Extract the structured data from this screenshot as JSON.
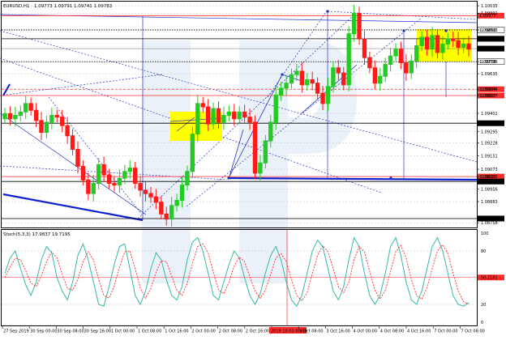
{
  "header": {
    "symbol": "EURUSD,H1",
    "ohlc": "1.09773 1.09791 1.09741 1.09783",
    "indicator": "Stoch(5,3,3) 17.9837 19.7195"
  },
  "colors": {
    "bull": "#22cc22",
    "bear": "#ff1a1a",
    "level": "#ff2a2a",
    "trend": "#2233cc",
    "box": "#ffff00",
    "stoch_main": "#34b8a8",
    "stoch_signal": "#ff2a2a",
    "watermark": "#dbe6f2"
  },
  "chart_data": [
    {
      "type": "candlestick",
      "title": "EURUSD,H1",
      "ylim": [
        1.0874,
        1.1005
      ],
      "y_ticks": [
        "1.10035",
        "1.09991",
        "1.09893",
        "1.09841",
        "1.09783",
        "1.09706",
        "1.09635",
        "1.09544",
        "1.09507",
        "1.09402",
        "1.09344",
        "1.09295",
        "1.09228",
        "1.09151",
        "1.09073",
        "1.09030",
        "1.09001",
        "1.08956",
        "1.08883",
        "1.08783",
        "1.08758"
      ],
      "grid": true,
      "levels": [
        {
          "value": 1.09977,
          "label": "1.09977",
          "style": "red-solid"
        },
        {
          "value": 1.09893,
          "label": "1.09893",
          "style": "black-dotted"
        },
        {
          "value": 1.09841,
          "label": "1.09841",
          "style": "black-solid"
        },
        {
          "value": 1.09783,
          "label": "1.09783",
          "style": "current"
        },
        {
          "value": 1.09706,
          "label": "1.09706",
          "style": "black-dotted"
        },
        {
          "value": 1.09544,
          "label": "1.09544",
          "style": "red-dashed"
        },
        {
          "value": 1.09507,
          "label": "1.09507",
          "style": "red-solid"
        },
        {
          "value": 1.09344,
          "label": "1.09344",
          "style": "black-solid"
        },
        {
          "value": 1.0903,
          "label": "1.09030",
          "style": "red-solid"
        },
        {
          "value": 1.09001,
          "label": "1.09001",
          "style": "black-solid"
        },
        {
          "value": 1.08783,
          "label": "1.08783",
          "style": "black-solid"
        }
      ],
      "anchor_prices": [
        1.094,
        1.0937,
        1.0939,
        1.0941,
        1.0946,
        1.0942,
        1.0936,
        1.0929,
        1.0935,
        1.0939,
        1.0938,
        1.0933,
        1.0927,
        1.0919,
        1.0909,
        1.0901,
        1.0893,
        1.0899,
        1.091,
        1.0904,
        1.0899,
        1.0898,
        1.0902,
        1.0906,
        1.0908,
        1.0899,
        1.0895,
        1.0893,
        1.0891,
        1.0888,
        1.0881,
        1.0878,
        1.0886,
        1.0889,
        1.0898,
        1.0906,
        1.0928,
        1.0946,
        1.0944,
        1.0934,
        1.0943,
        1.0935,
        1.0939,
        1.0941,
        1.0937,
        1.0941,
        1.0938,
        1.0935,
        1.0905,
        1.0911,
        1.0924,
        1.0935,
        1.0951,
        1.0955,
        1.0958,
        1.0963,
        1.0965,
        1.0957,
        1.096,
        1.0958,
        1.0952,
        1.0946,
        1.0956,
        1.0967,
        1.0964,
        1.0957,
        1.0987,
        1.0999,
        1.0984,
        1.0973,
        1.0967,
        1.0958,
        1.0962,
        1.0969,
        1.0974,
        1.0978,
        1.097,
        1.0964,
        1.0971,
        1.098,
        1.0985,
        1.0978,
        1.0986,
        1.0976,
        1.0981,
        1.0984,
        1.0983,
        1.0979,
        1.0981,
        1.0978
      ]
    },
    {
      "type": "line",
      "title": "Stoch(5,3,3) 17.9837 19.7195",
      "ylim": [
        0,
        100
      ],
      "y_ticks": [
        "100",
        "80",
        "50.2181",
        "20",
        "0"
      ],
      "levels": [
        80,
        50.2181,
        20
      ],
      "series": [
        {
          "values": [
            55,
            72,
            80,
            60,
            42,
            30,
            45,
            70,
            85,
            78,
            50,
            35,
            25,
            45,
            75,
            88,
            70,
            45,
            20,
            18,
            40,
            65,
            85,
            88,
            60,
            30,
            20,
            35,
            60,
            78,
            70,
            48,
            30,
            25,
            40,
            70,
            90,
            95,
            80,
            55,
            30,
            25,
            45,
            65,
            80,
            72,
            50,
            30,
            20,
            32,
            55,
            75,
            85,
            70,
            45,
            25,
            18,
            30,
            55,
            80,
            92,
            85,
            60,
            35,
            25,
            40,
            70,
            95,
            85,
            55,
            30,
            20,
            30,
            55,
            85,
            95,
            75,
            45,
            25,
            20,
            35,
            60,
            85,
            95,
            80,
            55,
            30,
            20,
            18,
            22
          ]
        },
        {
          "values": [
            50,
            62,
            72,
            70,
            58,
            44,
            40,
            52,
            68,
            79,
            72,
            54,
            38,
            36,
            48,
            68,
            79,
            70,
            48,
            30,
            27,
            41,
            62,
            79,
            80,
            60,
            38,
            27,
            38,
            56,
            69,
            68,
            52,
            36,
            30,
            44,
            66,
            85,
            88,
            78,
            56,
            36,
            32,
            45,
            63,
            73,
            68,
            51,
            35,
            27,
            36,
            54,
            72,
            77,
            68,
            48,
            30,
            24,
            33,
            55,
            75,
            86,
            79,
            60,
            40,
            33,
            45,
            70,
            85,
            79,
            57,
            36,
            26,
            36,
            57,
            79,
            86,
            72,
            48,
            30,
            26,
            39,
            60,
            80,
            87,
            77,
            55,
            35,
            23,
            20
          ]
        }
      ]
    }
  ],
  "x_axis": {
    "labels": [
      "27 Sep 2019",
      "30 Sep 00:00",
      "30 Sep 08:00",
      "30 Sep 16:00",
      "1 Oct 00:00",
      "1 Oct 08:00",
      "1 Oct 16:00",
      "2 Oct 00:00",
      "2 Oct 08:00",
      "2 Oct 16:00",
      "2019.10.03 00:00",
      "3 Oct 08:00",
      "3 Oct 16:00",
      "4 Oct 00:00",
      "4 Oct 08:00",
      "4 Oct 16:00",
      "7 Oct 00:00",
      "7 Oct 08:00"
    ],
    "highlighted": "2019.10.03 00:00"
  }
}
